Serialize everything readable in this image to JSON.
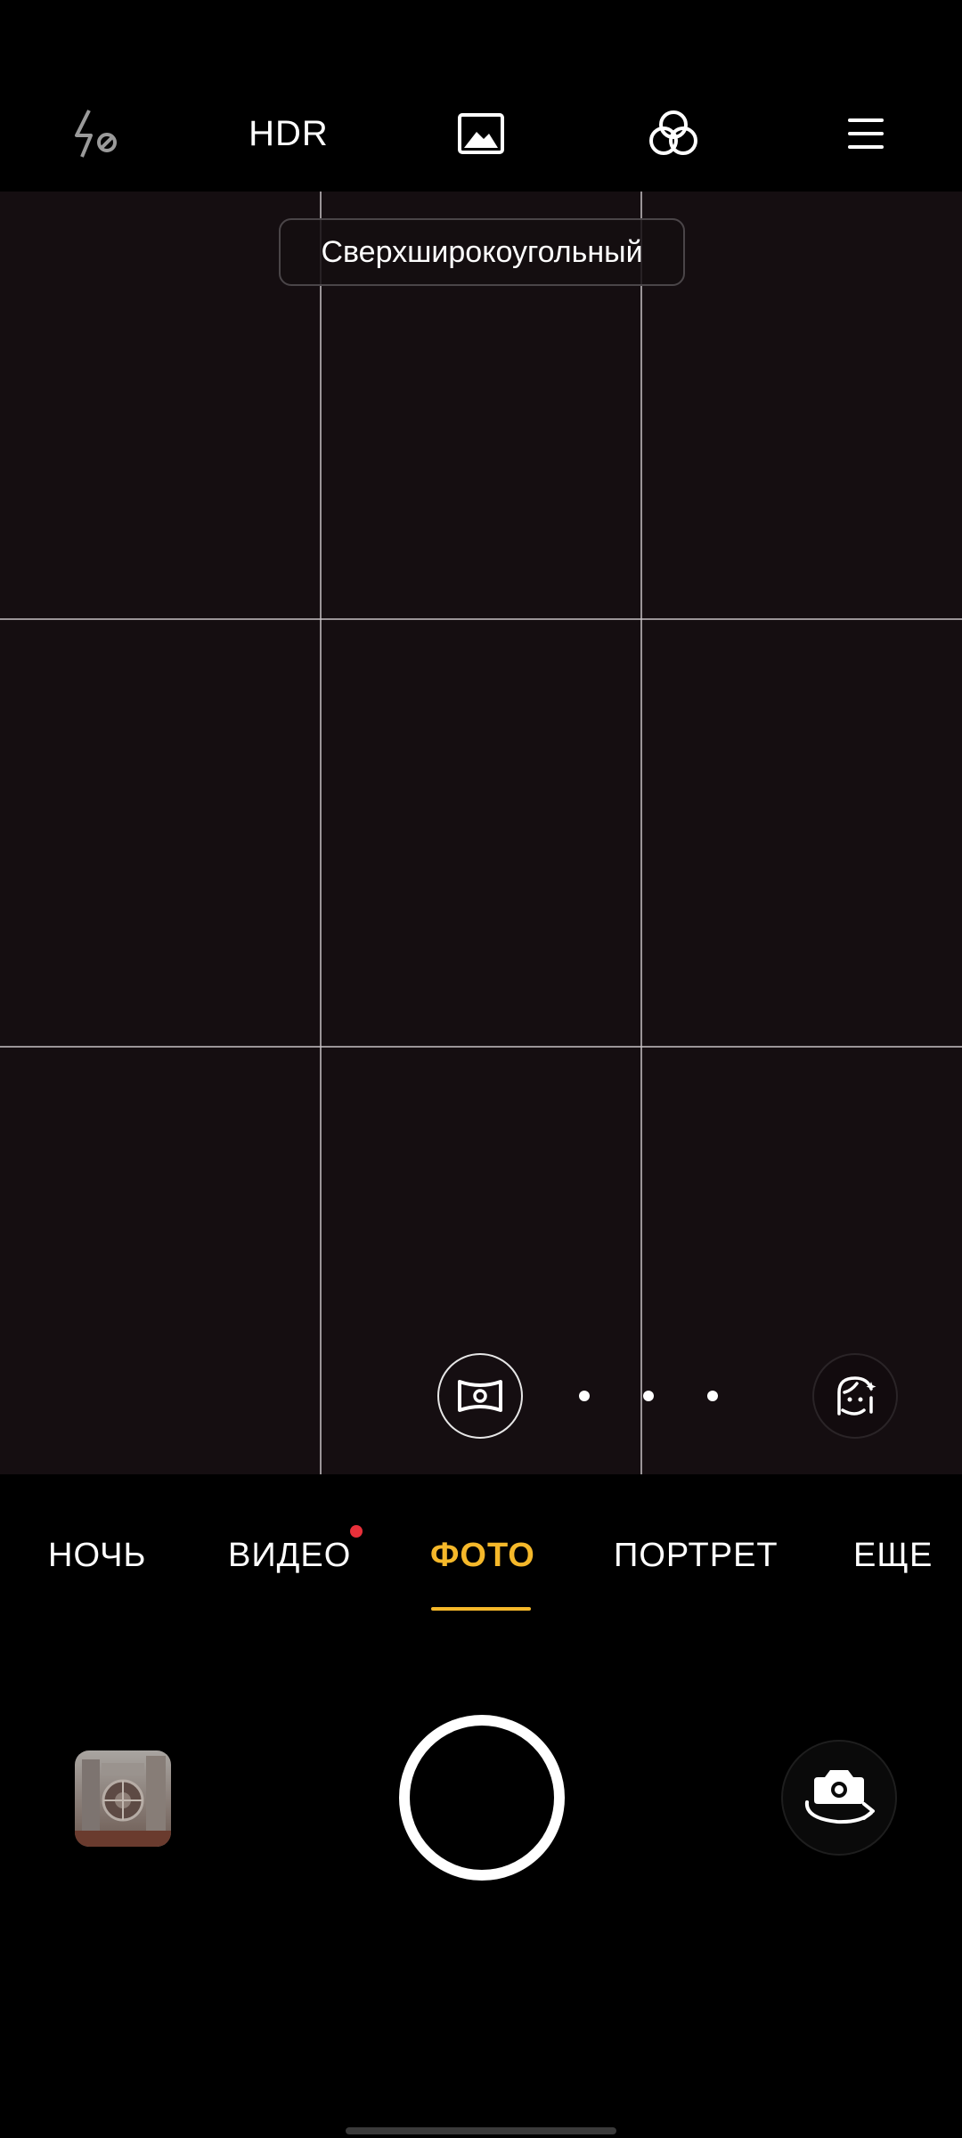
{
  "topbar": {
    "flash_icon": "flash-off-icon",
    "hdr_label": "HDR",
    "aspect_icon": "image-frame-icon",
    "filters_icon": "color-filters-icon",
    "menu_icon": "menu-icon"
  },
  "viewfinder": {
    "lens_label": "Сверхширокоугольный",
    "grid": "3x3",
    "left_button_icon": "panorama-lens-icon",
    "right_button_icon": "beauty-face-icon"
  },
  "modes": {
    "items": [
      "НОЧЬ",
      "ВИДЕО",
      "ФОТО",
      "ПОРТРЕТ",
      "ЕЩЕ"
    ],
    "selected": "ФОТО",
    "new_badge_on": "ВИДЕО"
  },
  "controls": {
    "gallery_icon": "last-photo-thumbnail",
    "shutter_icon": "shutter-button",
    "switch_icon": "camera-switch-icon"
  },
  "colors": {
    "accent": "#f5b82a",
    "badge": "#e8303a",
    "viewfinder_bg": "#150e11"
  }
}
